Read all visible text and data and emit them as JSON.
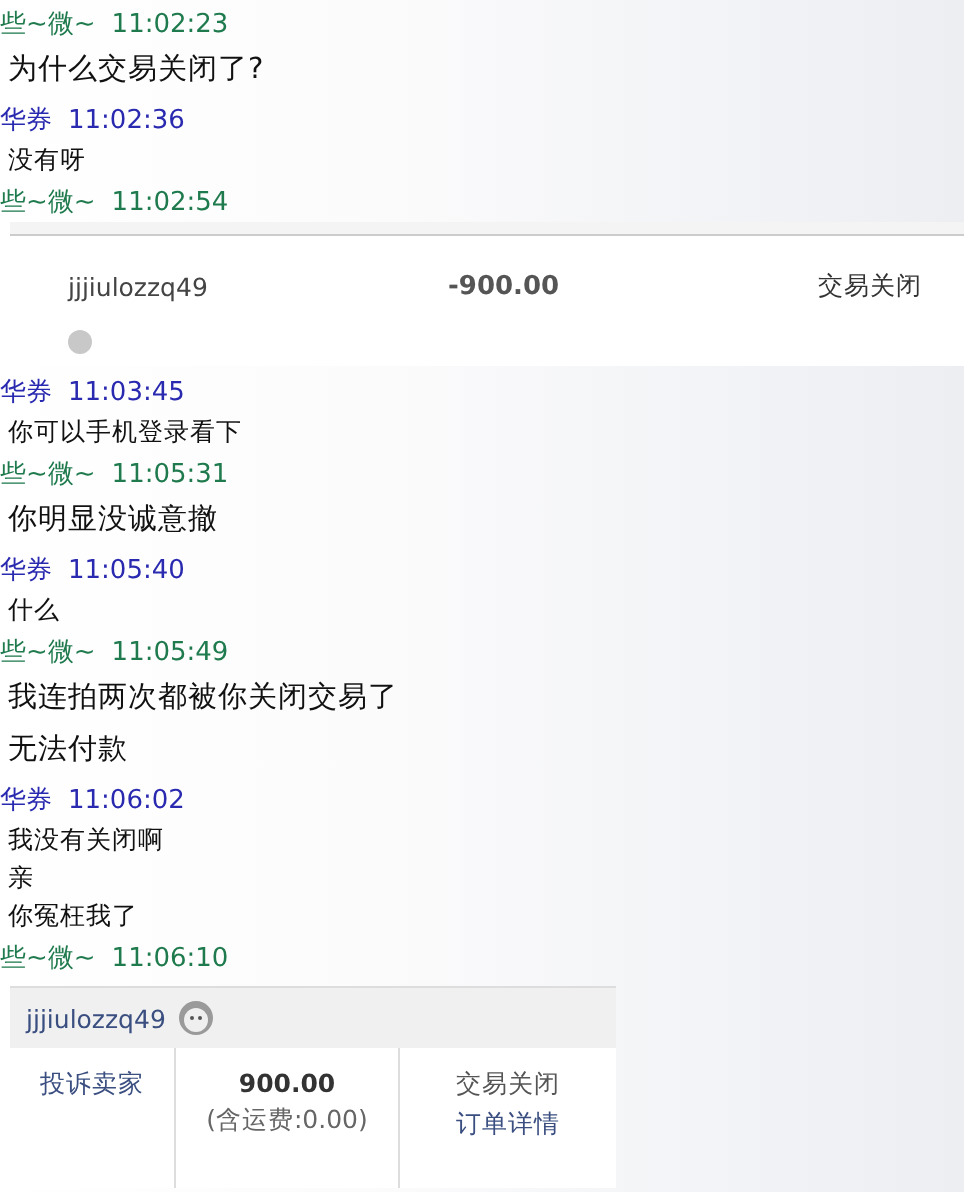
{
  "messages": [
    {
      "kind": "buyer",
      "sender": "些~微~",
      "time": "11:02:23",
      "lines": [
        "为什么交易关闭了?"
      ]
    },
    {
      "kind": "seller",
      "sender": "华券",
      "time": "11:02:36",
      "lines": [
        "没有呀"
      ]
    },
    {
      "kind": "buyer",
      "sender": "些~微~",
      "time": "11:02:54",
      "attachment": {
        "kind": "order-row",
        "buyer": "jjjiulozzq49",
        "amount": "-900.00",
        "status": "交易关闭"
      }
    },
    {
      "kind": "seller",
      "sender": "华券",
      "time": "11:03:45",
      "lines": [
        "你可以手机登录看下"
      ]
    },
    {
      "kind": "buyer",
      "sender": "些~微~",
      "time": "11:05:31",
      "lines": [
        "你明显没诚意撤"
      ]
    },
    {
      "kind": "seller",
      "sender": "华券",
      "time": "11:05:40",
      "lines": [
        "什么"
      ]
    },
    {
      "kind": "buyer",
      "sender": "些~微~",
      "time": "11:05:49",
      "lines": [
        "我连拍两次都被你关闭交易了",
        "无法付款"
      ]
    },
    {
      "kind": "seller",
      "sender": "华券",
      "time": "11:06:02",
      "lines": [
        "我没有关闭啊",
        "亲",
        "你冤枉我了"
      ]
    },
    {
      "kind": "buyer",
      "sender": "些~微~",
      "time": "11:06:10",
      "attachment": {
        "kind": "order-card",
        "buyer": "jjjiulozzq49",
        "complain": "投诉卖家",
        "amount": "900.00",
        "fee": "(含运费:0.00)",
        "status": "交易关闭",
        "detail": "订单详情"
      }
    }
  ]
}
